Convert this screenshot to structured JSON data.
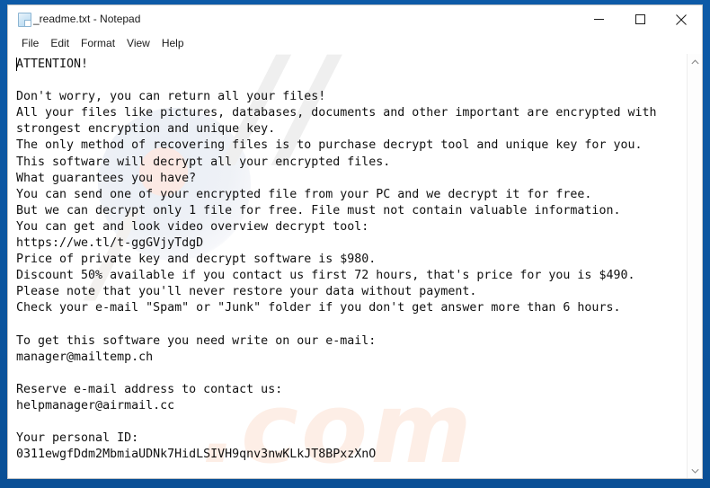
{
  "window": {
    "title": "_readme.txt - Notepad",
    "icon": "notepad-document-icon",
    "controls": {
      "minimize": "Minimize",
      "maximize": "Maximize",
      "close": "Close"
    }
  },
  "menubar": {
    "items": [
      {
        "label": "File"
      },
      {
        "label": "Edit"
      },
      {
        "label": "Format"
      },
      {
        "label": "View"
      },
      {
        "label": "Help"
      }
    ]
  },
  "editor": {
    "content": "ATTENTION!\n\nDon't worry, you can return all your files!\nAll your files like pictures, databases, documents and other important are encrypted with\nstrongest encryption and unique key.\nThe only method of recovering files is to purchase decrypt tool and unique key for you.\nThis software will decrypt all your encrypted files.\nWhat guarantees you have?\nYou can send one of your encrypted file from your PC and we decrypt it for free.\nBut we can decrypt only 1 file for free. File must not contain valuable information.\nYou can get and look video overview decrypt tool:\nhttps://we.tl/t-ggGVjyTdgD\nPrice of private key and decrypt software is $980.\nDiscount 50% available if you contact us first 72 hours, that's price for you is $490.\nPlease note that you'll never restore your data without payment.\nCheck your e-mail \"Spam\" or \"Junk\" folder if you don't get answer more than 6 hours.\n\nTo get this software you need write on our e-mail:\nmanager@mailtemp.ch\n\nReserve e-mail address to contact us:\nhelpmanager@airmail.cc\n\nYour personal ID:\n0311ewgfDdm2MbmiaUDNk7HidLSIVH9qnv3nwKLkJT8BPxzXnO",
    "ransom_details": {
      "video_overview_url": "https://we.tl/t-ggGVjyTdgD",
      "full_price": "$980",
      "discount_price": "$490",
      "discount_percent": "50%",
      "discount_window": "72 hours",
      "response_time": "6 hours",
      "primary_email": "manager@mailtemp.ch",
      "reserve_email": "helpmanager@airmail.cc",
      "personal_id": "0311ewgfDdm2MbmiaUDNk7HidLSIVH9qnv3nwKLkJT8BPxzXnO"
    }
  },
  "watermark": {
    "shape_text": "//",
    "secondary_text": "/",
    "domain_text": ".com"
  },
  "scrollbar": {
    "up_arrow": "scroll-up",
    "down_arrow": "scroll-down"
  },
  "colors": {
    "desktop_blue": "#0b559f",
    "window_bg": "#ffffff",
    "text": "#101010"
  }
}
